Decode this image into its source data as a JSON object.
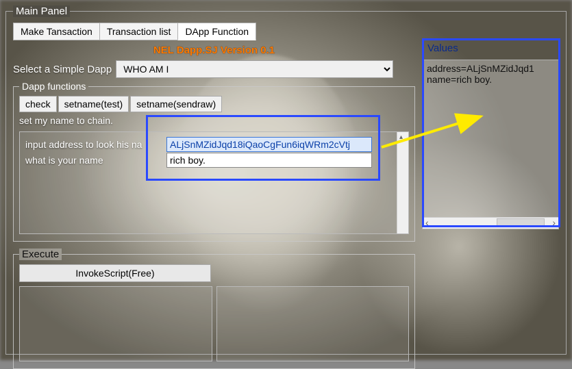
{
  "panel": {
    "title": "Main Panel"
  },
  "tabs": [
    {
      "label": "Make Tansaction",
      "active": false
    },
    {
      "label": "Transaction list",
      "active": false
    },
    {
      "label": "DApp Function",
      "active": true
    }
  ],
  "version": "NEL Dapp.SJ Version 0.1",
  "selectLabel": "Select a Simple Dapp",
  "selectedDapp": "WHO AM I",
  "functions": {
    "legend": "Dapp functions",
    "buttons": [
      "check",
      "setname(test)",
      "setname(sendraw)"
    ],
    "description": "set my name to chain.",
    "fields": [
      {
        "label": "input address to look his na",
        "value": "ALjSnMZidJqd18iQaoCgFun6iqWRm2cVtj",
        "selected": true
      },
      {
        "label": "what is your name",
        "value": "rich boy.",
        "selected": false
      }
    ]
  },
  "values": {
    "legend": "Values",
    "lines": [
      "address=ALjSnMZidJqd1",
      "name=rich boy."
    ]
  },
  "execute": {
    "legend": "Execute",
    "button": "InvokeScript(Free)"
  }
}
